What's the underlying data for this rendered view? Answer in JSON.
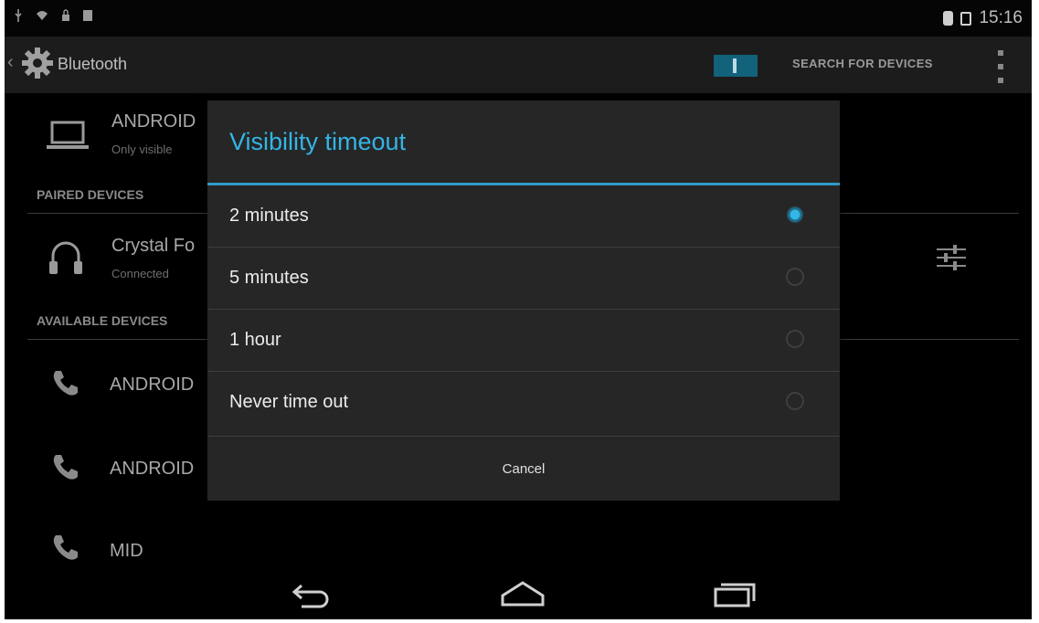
{
  "status_bar": {
    "time": "15:16"
  },
  "action_bar": {
    "back": "‹",
    "title": "Bluetooth",
    "search_label": "SEARCH FOR DEVICES",
    "gear_icon": "gear-icon",
    "toggle_state": "on"
  },
  "device_name": {
    "title": "ANDROID",
    "subtitle": "Only visible"
  },
  "paired_header": "PAIRED DEVICES",
  "paired_device": {
    "title": "Crystal Fo",
    "subtitle": "Connected"
  },
  "available_header": "AVAILABLE DEVICES",
  "available_devices": [
    {
      "title": "ANDROID"
    },
    {
      "title": "ANDROID"
    },
    {
      "title": "MID"
    }
  ],
  "dialog": {
    "title": "Visibility timeout",
    "options": [
      {
        "label": "2 minutes",
        "selected": true
      },
      {
        "label": "5 minutes",
        "selected": false
      },
      {
        "label": "1 hour",
        "selected": false
      },
      {
        "label": "Never time out",
        "selected": false
      }
    ],
    "cancel_label": "Cancel"
  },
  "colors": {
    "accent": "#33b5e5",
    "toggle": "#11627a",
    "dialog_bg": "#262626"
  }
}
